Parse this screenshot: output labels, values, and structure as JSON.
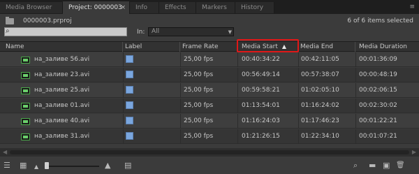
{
  "tabs": [
    {
      "label": "Media Browser",
      "active": false
    },
    {
      "label": "Project: 0000003",
      "active": true
    },
    {
      "label": "Info",
      "active": false
    },
    {
      "label": "Effects",
      "active": false
    },
    {
      "label": "Markers",
      "active": false
    },
    {
      "label": "History",
      "active": false
    }
  ],
  "tab_close_glyph": "×",
  "panel_menu_glyph": "≡",
  "project": {
    "name": "0000003.prproj",
    "selection_status": "6 of 6 items selected"
  },
  "search": {
    "value": "",
    "icon_glyph": "⌕",
    "in_label": "In:",
    "in_value": "All",
    "dropdown_glyph": "▼"
  },
  "columns": {
    "name": "Name",
    "label": "Label",
    "frame_rate": "Frame Rate",
    "media_start": "Media Start",
    "sort_glyph": "▲",
    "media_end": "Media End",
    "media_duration": "Media Duration"
  },
  "rows": [
    {
      "name": "на_заливе 56.avi",
      "frame_rate": "25,00 fps",
      "media_start": "00:40:34:22",
      "media_end": "00:42:11:05",
      "media_duration": "00:01:36:09"
    },
    {
      "name": "на_заливе 23.avi",
      "frame_rate": "25,00 fps",
      "media_start": "00:56:49:14",
      "media_end": "00:57:38:07",
      "media_duration": "00:00:48:19"
    },
    {
      "name": "на_заливе 25.avi",
      "frame_rate": "25,00 fps",
      "media_start": "00:59:58:21",
      "media_end": "01:02:05:10",
      "media_duration": "00:02:06:15"
    },
    {
      "name": "на_заливе 01.avi",
      "frame_rate": "25,00 fps",
      "media_start": "01:13:54:01",
      "media_end": "01:16:24:02",
      "media_duration": "00:02:30:02"
    },
    {
      "name": "на_заливе 40.avi",
      "frame_rate": "25,00 fps",
      "media_start": "01:16:24:03",
      "media_end": "01:17:46:23",
      "media_duration": "00:01:22:21"
    },
    {
      "name": "на_заливе 31.avi",
      "frame_rate": "25,00 fps",
      "media_start": "01:21:26:15",
      "media_end": "01:22:34:10",
      "media_duration": "00:01:07:21"
    }
  ],
  "colors": {
    "label_swatch": "#7aa6de",
    "sort_highlight": "#e01818",
    "clip_icon": "#4aa84a"
  },
  "toolbar": {
    "list_view_glyph": "☰",
    "icon_view_glyph": "▦",
    "zoom_out_glyph": "▲",
    "zoom_in_glyph": "▲",
    "automate_glyph": "▤",
    "find_glyph": "⌕",
    "new_bin_glyph": "▬",
    "new_item_glyph": "▣",
    "delete_glyph": "🗑"
  }
}
